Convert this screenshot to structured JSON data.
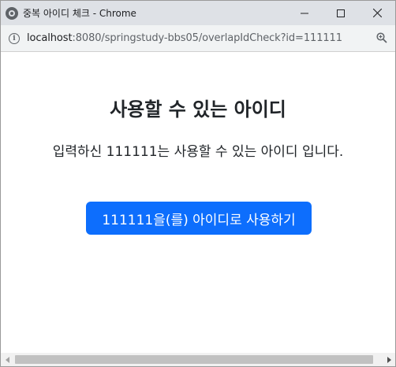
{
  "window": {
    "title": "중복 아이디 체크 - Chrome",
    "controls": [
      "minimize",
      "maximize",
      "close"
    ]
  },
  "address_bar": {
    "host": "localhost",
    "path": ":8080/springstudy-bbs05/overlapIdCheck?id=111111"
  },
  "page": {
    "heading": "사용할 수 있는 아이디",
    "message": "입력하신 111111는 사용할 수 있는 아이디 입니다.",
    "use_button_label": "111111을(를) 아이디로 사용하기"
  },
  "colors": {
    "titlebar": "#dee1e6",
    "button": "#0d6efd",
    "text": "#212529"
  },
  "icons": {
    "app": "chrome-icon",
    "info": "info-icon",
    "zoom": "zoom-icon"
  }
}
